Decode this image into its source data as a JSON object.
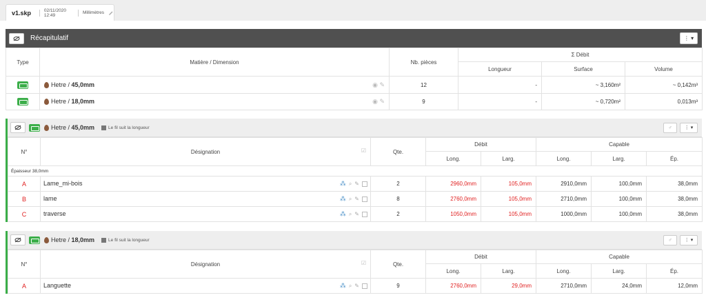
{
  "file": {
    "name": "v1.skp",
    "date": "02/11/2020 12:49",
    "unit": "Millimètres"
  },
  "summary": {
    "title": "Récapitulatif",
    "headers": {
      "type": "Type",
      "material": "Matière / Dimension",
      "pieces": "Nb. pièces",
      "debit": "Σ Débit",
      "length": "Longueur",
      "surface": "Surface",
      "volume": "Volume"
    },
    "rows": [
      {
        "mat": "Hetre / ",
        "dim": "45,0mm",
        "pieces": "12",
        "length": "-",
        "surface": "~ 3,160m²",
        "volume": "~ 0,142m³"
      },
      {
        "mat": "Hetre / ",
        "dim": "18,0mm",
        "pieces": "9",
        "length": "-",
        "surface": "~ 0,720m²",
        "volume": "0,013m³"
      }
    ]
  },
  "groups": [
    {
      "mat": "Hetre / ",
      "dim": "45,0mm",
      "grain": "Le fil suit la longueur",
      "headers": {
        "num": "N°",
        "designation": "Désignation",
        "qty": "Qte.",
        "debit": "Débit",
        "capable": "Capable",
        "long": "Long.",
        "larg": "Larg.",
        "long2": "Long.",
        "larg2": "Larg.",
        "ep": "Ép."
      },
      "thickness_note": "Épaisseur 38,0mm",
      "rows": [
        {
          "id": "A",
          "name": "Lame_mi-bois",
          "qty": "2",
          "dlong": "2960,0mm",
          "dlarg": "105,0mm",
          "clong": "2910,0mm",
          "clarg": "100,0mm",
          "cep": "38,0mm"
        },
        {
          "id": "B",
          "name": "lame",
          "qty": "8",
          "dlong": "2760,0mm",
          "dlarg": "105,0mm",
          "clong": "2710,0mm",
          "clarg": "100,0mm",
          "cep": "38,0mm"
        },
        {
          "id": "C",
          "name": "traverse",
          "qty": "2",
          "dlong": "1050,0mm",
          "dlarg": "105,0mm",
          "clong": "1000,0mm",
          "clarg": "100,0mm",
          "cep": "38,0mm"
        }
      ]
    },
    {
      "mat": "Hetre / ",
      "dim": "18,0mm",
      "grain": "Le fil suit la longueur",
      "headers": {
        "num": "N°",
        "designation": "Désignation",
        "qty": "Qte.",
        "debit": "Débit",
        "capable": "Capable",
        "long": "Long.",
        "larg": "Larg.",
        "long2": "Long.",
        "larg2": "Larg.",
        "ep": "Ép."
      },
      "rows": [
        {
          "id": "A",
          "name": "Languette",
          "qty": "9",
          "dlong": "2760,0mm",
          "dlarg": "29,0mm",
          "clong": "2710,0mm",
          "clarg": "24,0mm",
          "cep": "12,0mm"
        }
      ]
    }
  ],
  "colors": {
    "accent": "#3bae49",
    "header": "#505050",
    "highlight": "#e02020"
  }
}
